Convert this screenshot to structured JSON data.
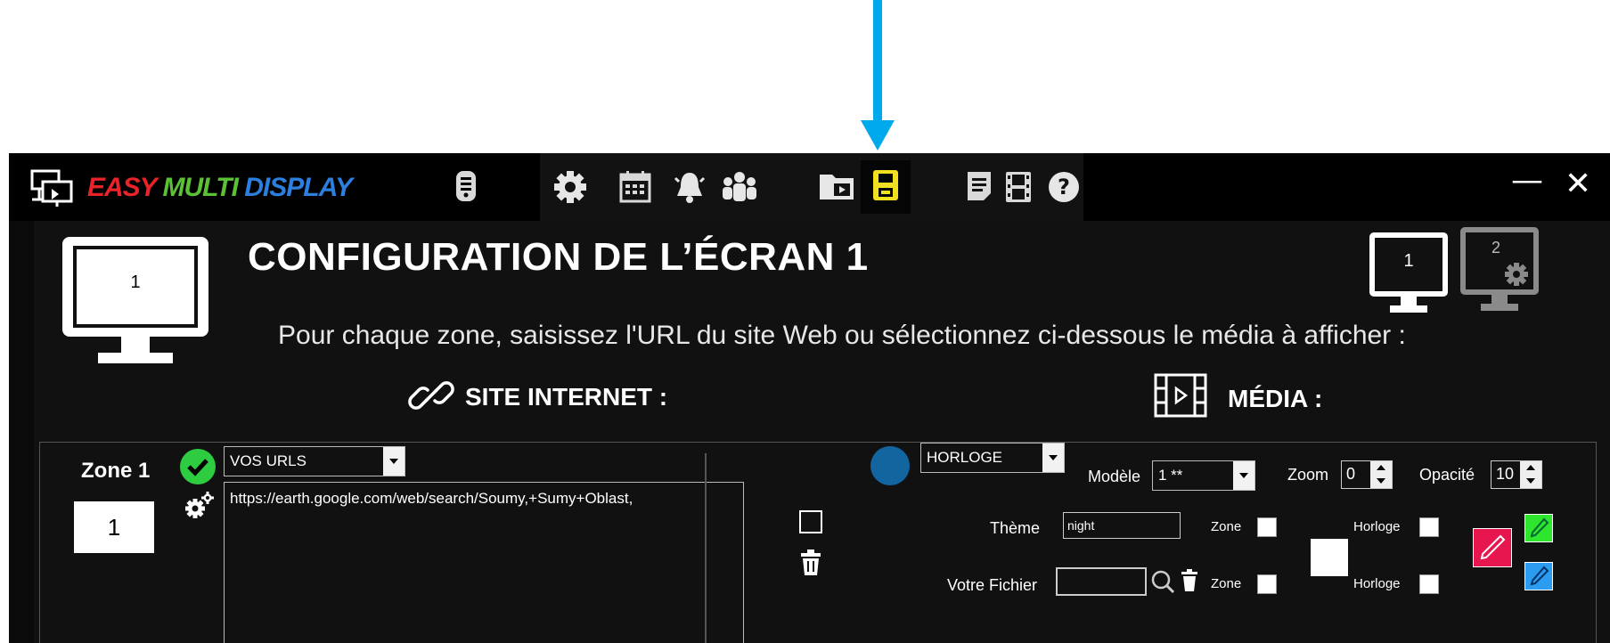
{
  "app": {
    "brand": {
      "part1": "EASY",
      "part2": "MULTI",
      "part3": "DISPLAY"
    },
    "toolbar_icons": [
      "remote-icon",
      "gear-icon",
      "calendar-icon",
      "bell-icon",
      "users-icon",
      "folder-play-icon",
      "save-icon",
      "document-icon",
      "film-icon",
      "help-icon"
    ],
    "window_buttons": {
      "minimize": "—",
      "close": "✕"
    }
  },
  "header": {
    "monitor_number": "1",
    "title": "CONFIGURATION DE L’ÉCRAN 1",
    "subtitle": "Pour chaque zone, saisissez l'URL du site Web ou sélectionnez ci-dessous le média à afficher :",
    "screens": [
      {
        "label": "1"
      },
      {
        "label": "2"
      }
    ]
  },
  "sections": {
    "web": "SITE INTERNET :",
    "media": "MÉDIA :"
  },
  "zone": {
    "title": "Zone 1",
    "number": "1",
    "url_source": "VOS URLS",
    "url_value": "https://earth.google.com/web/search/Soumy,+Sumy+Oblast,",
    "media_type": "HORLOGE",
    "modele_label": "Modèle",
    "modele_value": "1 **",
    "zoom_label": "Zoom",
    "zoom_value": "0",
    "opacite_label": "Opacité",
    "opacite_value": "10",
    "theme_label": "Thème",
    "theme_value": "night",
    "fichier_label": "Votre Fichier",
    "fichier_value": "",
    "zone_label": "Zone",
    "horloge_label": "Horloge"
  },
  "colors": {
    "arrow": "#00a8ec",
    "brand_red": "#e8232a",
    "brand_green": "#5bc236",
    "brand_blue": "#2b7fe0",
    "status_green": "#2ecc40",
    "media_circle": "#12659e",
    "picker_red": "#e8164f",
    "picker_green": "#2ee62e",
    "picker_blue": "#2b9cf0",
    "save_highlight": "#f0e020"
  }
}
